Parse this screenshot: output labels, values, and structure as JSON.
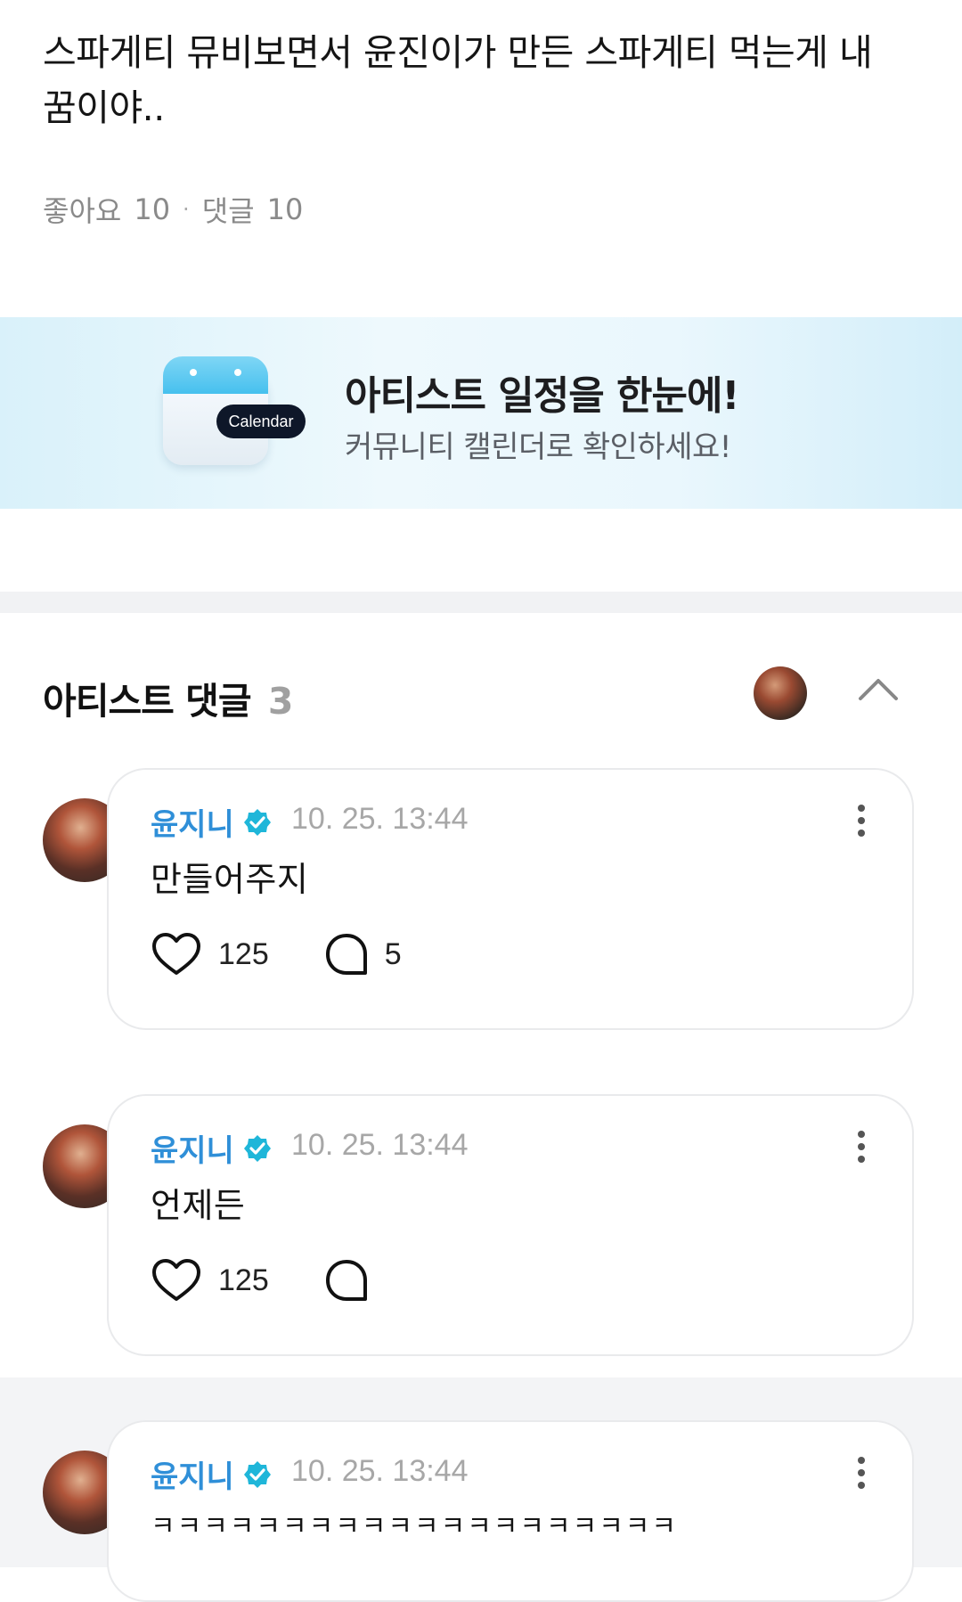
{
  "post": {
    "text": "스파게티 뮤비보면서 윤진이가 만든  스파게티 먹는게 내 꿈이야..",
    "likes_label": "좋아요",
    "likes_count": "10",
    "separator": "·",
    "comments_label": "댓글",
    "comments_count": "10"
  },
  "banner": {
    "icon_tag": "Calendar",
    "title": "아티스트 일정을 한눈에!",
    "subtitle": "커뮤니티 캘린더로 확인하세요!"
  },
  "artist_comments": {
    "title": "아티스트 댓글",
    "count": "3",
    "items": [
      {
        "name": "윤지니",
        "time": "10. 25. 13:44",
        "text": "만들어주지",
        "likes": "125",
        "replies": "5"
      },
      {
        "name": "윤지니",
        "time": "10. 25. 13:44",
        "text": "언제든",
        "likes": "125",
        "replies": ""
      },
      {
        "name": "윤지니",
        "time": "10. 25. 13:44",
        "text": "ㅋㅋㅋㅋㅋㅋㅋㅋㅋㅋㅋㅋㅋㅋㅋㅋㅋㅋㅋㅋ",
        "likes": "",
        "replies": ""
      }
    ]
  },
  "colors": {
    "name_blue": "#2f8fd8",
    "verified_teal": "#1fb6d9",
    "meta_gray": "#8a8a8a",
    "time_gray": "#a7a7a7"
  },
  "icons": [
    "verified-badge-icon",
    "more-vertical-icon",
    "heart-icon",
    "speech-bubble-icon",
    "chevron-up-icon",
    "calendar-icon"
  ]
}
